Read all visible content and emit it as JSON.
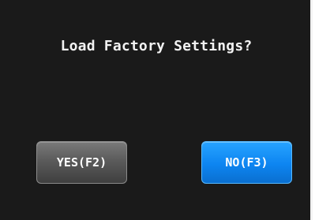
{
  "dialog": {
    "prompt": "Load Factory Settings?",
    "yes_label": "YES(F2)",
    "no_label": "NO(F3)"
  },
  "colors": {
    "background": "#1a1a1a",
    "yes_button": "#5b5b5b",
    "no_button": "#0d85f1",
    "text": "#f2f2f2"
  }
}
